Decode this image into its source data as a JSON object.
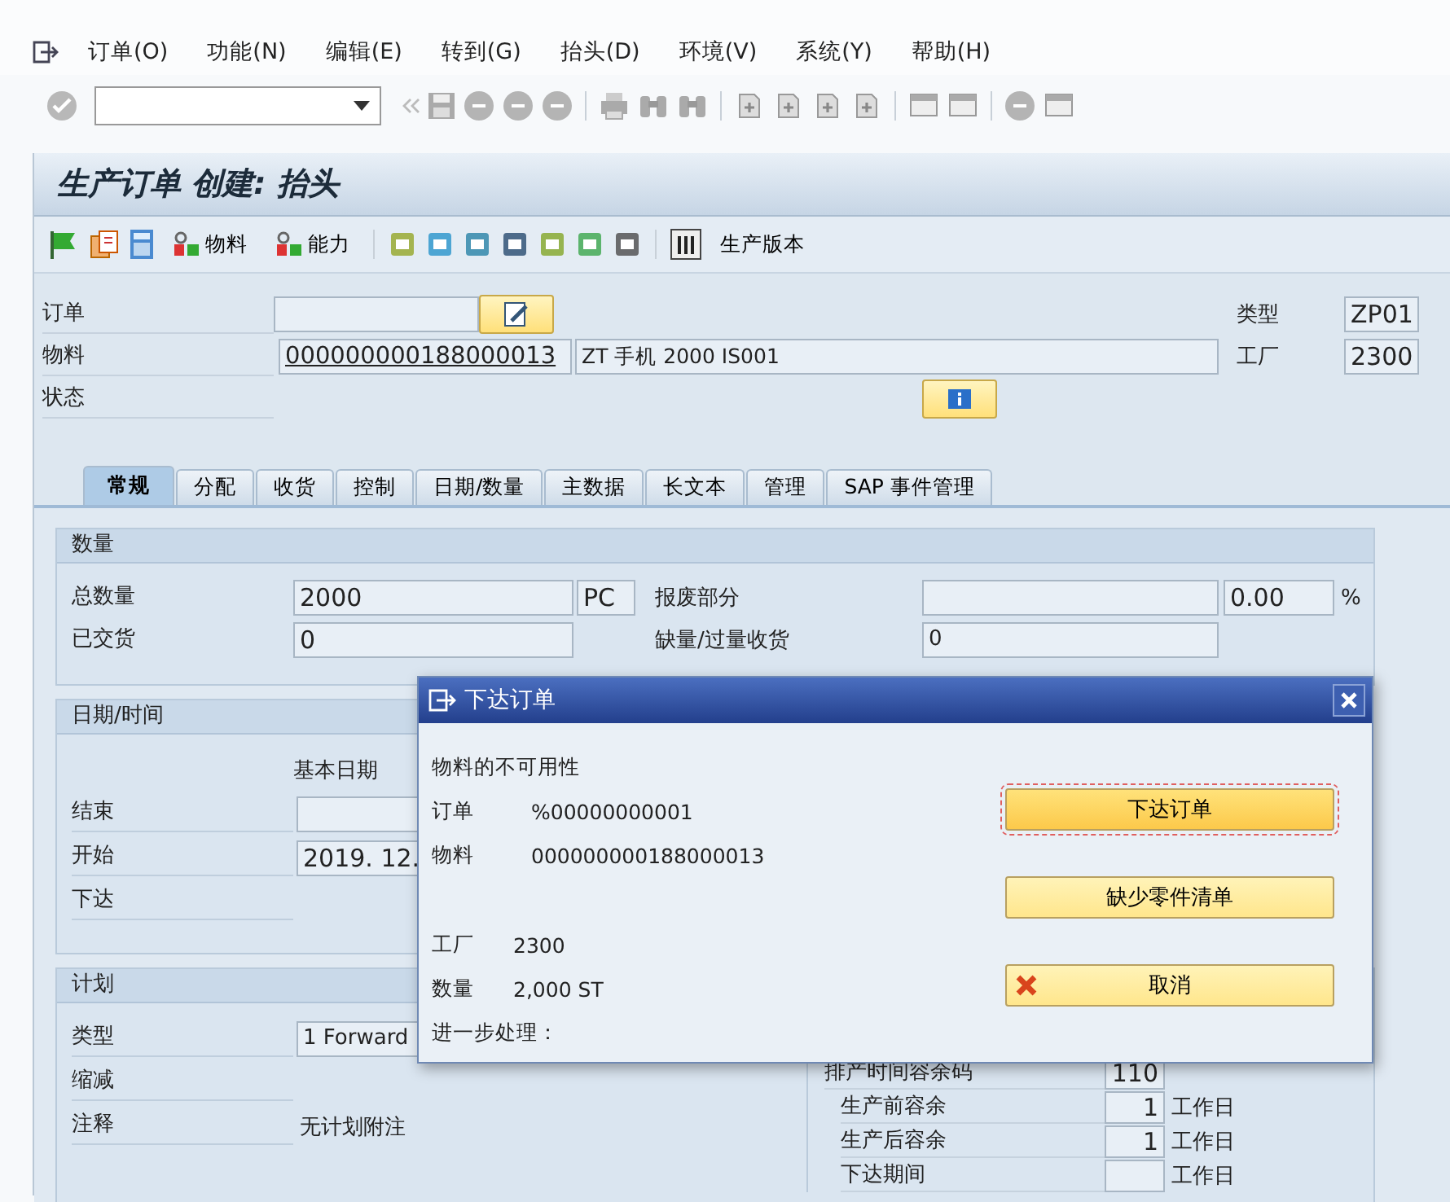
{
  "menu": [
    {
      "label": "订单(O)"
    },
    {
      "label": "功能(N)"
    },
    {
      "label": "编辑(E)"
    },
    {
      "label": "转到(G)"
    },
    {
      "label": "抬头(D)"
    },
    {
      "label": "环境(V)"
    },
    {
      "label": "系统(Y)"
    },
    {
      "label": "帮助(H)"
    }
  ],
  "title": "生产订单 创建: 抬头",
  "app_toolbar": {
    "buttons": [
      {
        "label": "物料"
      },
      {
        "label": "能力"
      },
      {
        "label": "生产版本"
      }
    ]
  },
  "header": {
    "order_label": "订单",
    "material_label": "物料",
    "material_number": "000000000188000013",
    "material_description": "ZT 手机 2000 IS001",
    "status_label": "状态",
    "type_label": "类型",
    "type_value": "ZP01",
    "plant_label": "工厂",
    "plant_value": "2300"
  },
  "tabs": [
    {
      "label": "常规",
      "selected": true
    },
    {
      "label": "分配",
      "selected": false
    },
    {
      "label": "收货",
      "selected": false
    },
    {
      "label": "控制",
      "selected": false
    },
    {
      "label": "日期/数量",
      "selected": false
    },
    {
      "label": "主数据",
      "selected": false
    },
    {
      "label": "长文本",
      "selected": false
    },
    {
      "label": "管理",
      "selected": false
    },
    {
      "label": "SAP 事件管理",
      "selected": false
    }
  ],
  "quantity": {
    "title": "数量",
    "total_label": "总数量",
    "total_value": "2000",
    "unit": "PC",
    "delivered_label": "已交货",
    "delivered_value": "0",
    "scrap_label": "报废部分",
    "scrap_percent": "0.00",
    "percent_sign": "%",
    "shortage_label": "缺量/过量收货",
    "shortage_value": "0"
  },
  "dates": {
    "title": "日期/时间",
    "column_header": "基本日期",
    "rows": [
      {
        "label": "结束",
        "kind": "field"
      },
      {
        "label": "开始",
        "kind": "field",
        "value": "2019. 12."
      },
      {
        "label": "下达",
        "kind": "none"
      }
    ]
  },
  "planning": {
    "title": "计划",
    "rows": [
      {
        "label": "类型",
        "kind": "dropdown",
        "value": "1 Forward"
      },
      {
        "label": "缩减",
        "kind": "none"
      },
      {
        "label": "注释",
        "kind": "text",
        "value": "无计划附注"
      }
    ],
    "margin_rows": [
      {
        "label": "排产时间容余码",
        "value": "110"
      },
      {
        "label": "生产前容余",
        "value": "1",
        "unit": "工作日"
      },
      {
        "label": "生产后容余",
        "value": "1",
        "unit": "工作日"
      },
      {
        "label": "下达期间",
        "unit": "工作日"
      }
    ]
  },
  "dialog": {
    "title": "下达订单",
    "heading": "物料的不可用性",
    "line_groups": [
      [
        {
          "label": "订单",
          "value": "%00000000001"
        },
        {
          "label": "物料",
          "value": "000000000188000013"
        }
      ],
      [
        {
          "label": "工厂",
          "value": "2300"
        },
        {
          "label": "数量",
          "value": "2,000 ST"
        }
      ]
    ],
    "footer": "进一步处理：",
    "buttons": [
      {
        "label": "下达订单",
        "kind": "plain",
        "focused": true
      },
      {
        "label": "缺少零件清单",
        "kind": "plain",
        "focused": false
      },
      {
        "label": "取消",
        "kind": "cancel",
        "focused": false
      }
    ]
  }
}
